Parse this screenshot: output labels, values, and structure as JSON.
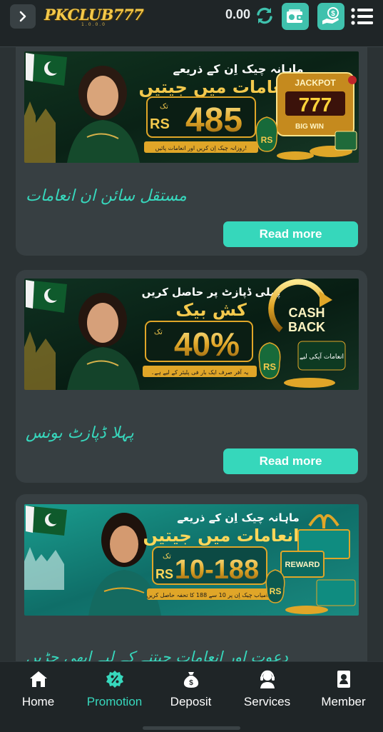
{
  "header": {
    "back_icon": "chevron-right-icon",
    "logo_text": "PKCLUB777",
    "logo_sub": "1.0.0.0",
    "balance": "0.00",
    "refresh_icon": "refresh-icon",
    "wallet_icon": "wallet-icon",
    "deposit_hand_icon": "money-hand-icon",
    "menu_icon": "menu-icon",
    "accent": "#3fc1ad"
  },
  "promotions": [
    {
      "title": "مستقل سائن ان انعامات",
      "read_more": "Read more",
      "banner": {
        "headline_1": "ماہانہ چیک اِن کے ذریعے",
        "headline_2": "انعامات میں جیتیں",
        "currency": "RS",
        "amount": "485",
        "tak": "تک",
        "footer": "روزانہ چیک اِن کریں اور انعامات پائیں!",
        "badge_1": "JACKPOT",
        "badge_2": "777",
        "badge_3": "BIG WIN",
        "bag": "RS"
      }
    },
    {
      "title": "پہلا ڈپازٹ بونس",
      "read_more": "Read more",
      "banner": {
        "headline_1": "پہلی ڈپازٹ پر حاصل کریں",
        "headline_2": "کش بیک",
        "amount": "40%",
        "tak": "تک",
        "footer": "یہ آفر صرف ایک بار فی پلیئر کے لیے ہے۔",
        "badge_1": "CASH",
        "badge_2": "BACK",
        "bag": "RS",
        "wallet_label": "انعامات آپکی لیے"
      }
    },
    {
      "title": "دعوت اور انعامات جیتنے کے لیے ابھی جڑیں",
      "banner": {
        "headline_1": "ماہانہ چیک اِن کے ذریعے",
        "headline_2": "انعامات میں جیتیں",
        "currency": "RS",
        "amount": "10-188",
        "tak": "تک",
        "footer": "کامیاب چیک اِن پر 10 سے 188 کا تحفہ حاصل کریں!",
        "badge_1": "REWARD",
        "bag": "RS"
      }
    }
  ],
  "nav": [
    {
      "label": "Home",
      "icon": "home-icon"
    },
    {
      "label": "Promotion",
      "icon": "promotion-icon",
      "active": true
    },
    {
      "label": "Deposit",
      "icon": "money-bag-icon"
    },
    {
      "label": "Services",
      "icon": "support-agent-icon"
    },
    {
      "label": "Member",
      "icon": "member-card-icon"
    }
  ]
}
